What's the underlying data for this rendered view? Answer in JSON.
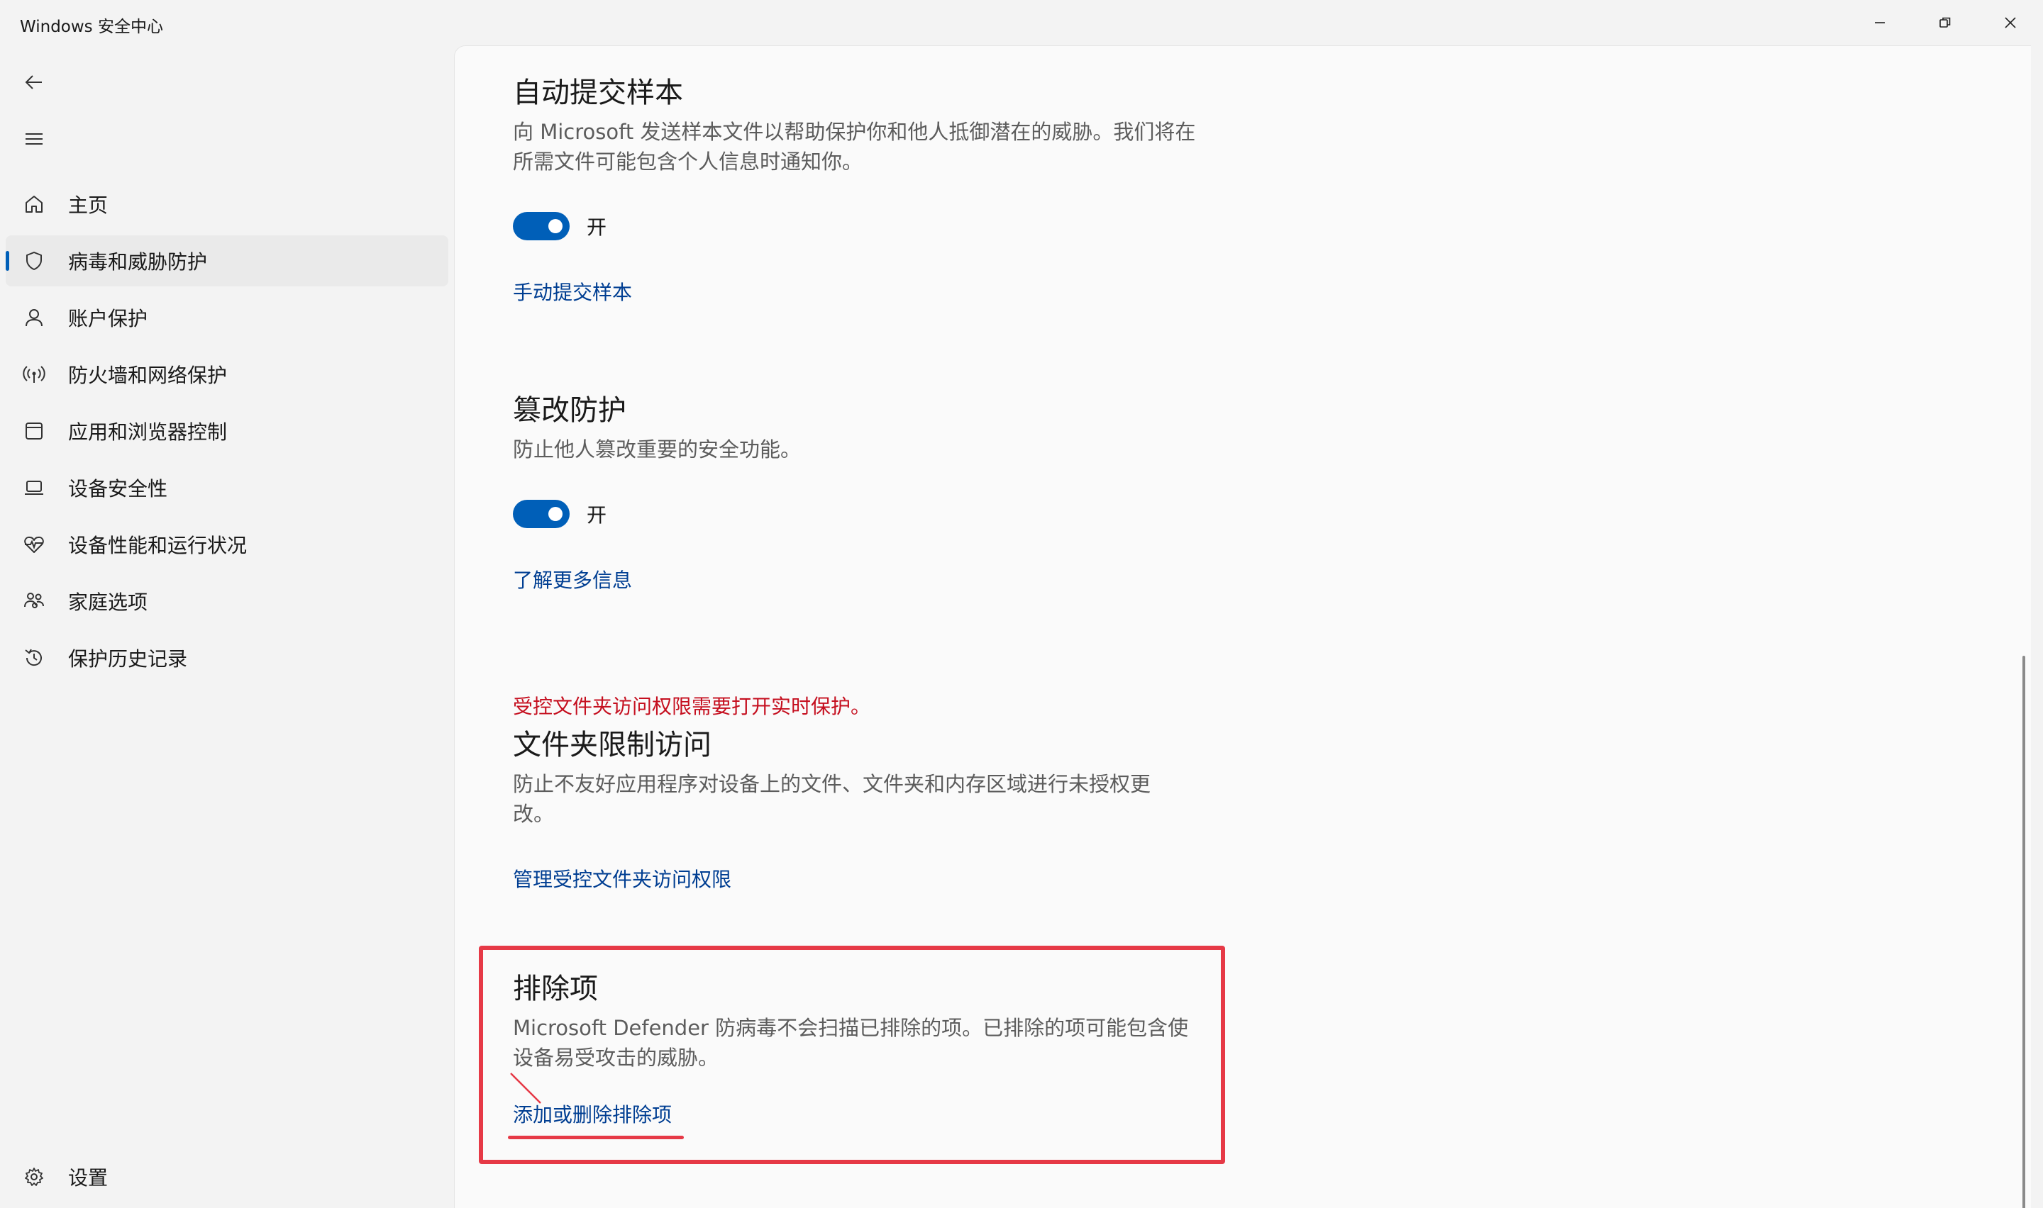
{
  "window": {
    "title": "Windows 安全中心",
    "controls": [
      "minimize",
      "restore",
      "close"
    ]
  },
  "sidebar": {
    "back_icon": "back-arrow-icon",
    "menu_icon": "hamburger-icon",
    "items": [
      {
        "label": "主页",
        "icon": "home-icon",
        "selected": false
      },
      {
        "label": "病毒和威胁防护",
        "icon": "shield-icon",
        "selected": true
      },
      {
        "label": "账户保护",
        "icon": "person-icon",
        "selected": false
      },
      {
        "label": "防火墙和网络保护",
        "icon": "antenna-icon",
        "selected": false
      },
      {
        "label": "应用和浏览器控制",
        "icon": "window-icon",
        "selected": false
      },
      {
        "label": "设备安全性",
        "icon": "laptop-icon",
        "selected": false
      },
      {
        "label": "设备性能和运行状况",
        "icon": "heartbeat-icon",
        "selected": false
      },
      {
        "label": "家庭选项",
        "icon": "family-icon",
        "selected": false
      },
      {
        "label": "保护历史记录",
        "icon": "history-icon",
        "selected": false
      }
    ],
    "settings": {
      "label": "设置",
      "icon": "gear-icon"
    }
  },
  "content": {
    "auto_submit": {
      "title": "自动提交样本",
      "description": "向 Microsoft 发送样本文件以帮助保护你和他人抵御潜在的威胁。我们将在所需文件可能包含个人信息时通知你。",
      "toggle_label": "开",
      "link": "手动提交样本"
    },
    "tamper": {
      "title": "篡改防护",
      "description": "防止他人篡改重要的安全功能。",
      "toggle_label": "开",
      "link": "了解更多信息"
    },
    "cfa": {
      "warning": "受控文件夹访问权限需要打开实时保护。",
      "title": "文件夹限制访问",
      "description": "防止不友好应用程序对设备上的文件、文件夹和内存区域进行未授权更改。",
      "link": "管理受控文件夹访问权限"
    },
    "exclusions": {
      "title": "排除项",
      "description": "Microsoft Defender 防病毒不会扫描已排除的项。已排除的项可能包含使设备易受攻击的威胁。",
      "link": "添加或删除排除项"
    }
  },
  "colors": {
    "accent": "#005fb8",
    "link": "#003e92",
    "warning": "#c50f1f",
    "annotation": "#e63946"
  }
}
